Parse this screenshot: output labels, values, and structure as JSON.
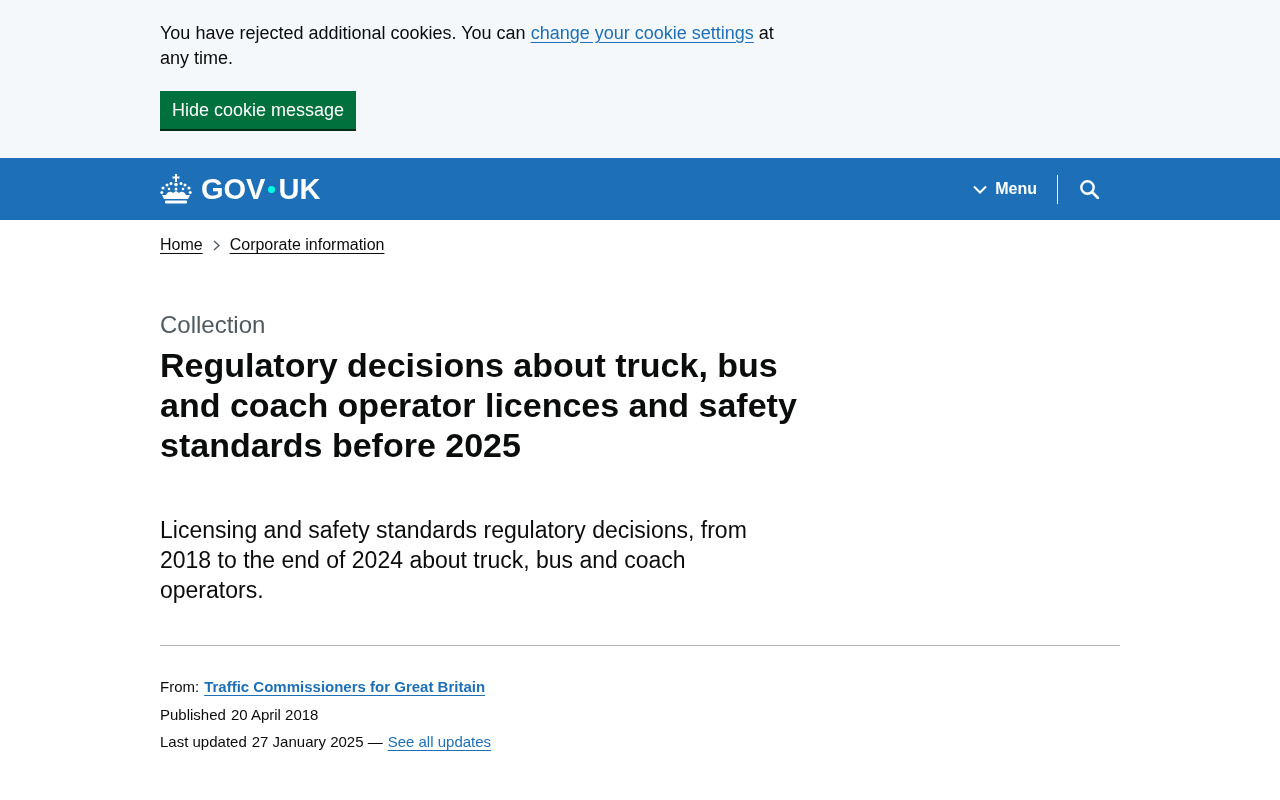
{
  "cookie_banner": {
    "text_before": "You have rejected additional cookies. You can",
    "link": "change your cookie settings",
    "text_after": "at any time.",
    "button": "Hide cookie message"
  },
  "header": {
    "logo_words": [
      "GOV",
      "UK"
    ],
    "menu_button": "Menu"
  },
  "breadcrumbs": [
    "Home",
    "Corporate information"
  ],
  "page": {
    "caption": "Collection",
    "title": "Regulatory decisions about truck, bus and coach operator licences and safety standards before 2025",
    "description": "Licensing and safety standards regulatory decisions, from 2018 to the end of 2024 about truck, bus and coach operators."
  },
  "metadata": {
    "from": {
      "label": "From:",
      "link": "Traffic Commissioners for Great Britain"
    },
    "published": {
      "label": "Published",
      "value": "20 April 2018"
    },
    "updated": {
      "label": "Last updated",
      "value": "27 January 2025 —",
      "link": "See all updates"
    }
  }
}
